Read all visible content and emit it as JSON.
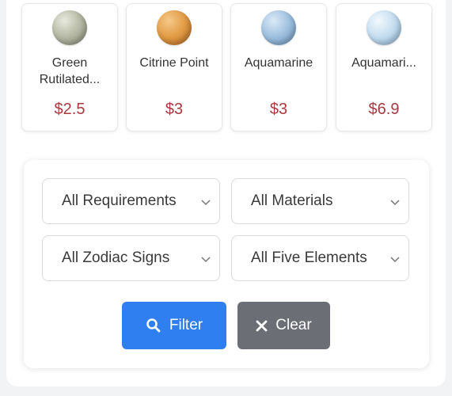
{
  "products": [
    {
      "name": "Green Rutilated...",
      "price": "$2.5",
      "icon": "green-rutilated-quartz-bead"
    },
    {
      "name": "Citrine Point",
      "price": "$3",
      "icon": "citrine-bead"
    },
    {
      "name": "Aquamarine",
      "price": "$3",
      "icon": "aquamarine-bead"
    },
    {
      "name": "Aquamari...",
      "price": "$6.9",
      "icon": "aquamarine-bead"
    }
  ],
  "filters": {
    "requirements": "All Requirements",
    "materials": "All Materials",
    "zodiac": "All Zodiac Signs",
    "elements": "All Five Elements"
  },
  "actions": {
    "filter_label": "Filter",
    "clear_label": "Clear"
  },
  "colors": {
    "price": "#a83a3f",
    "filter_button": "#2f7ff0",
    "clear_button": "#6b6f75"
  }
}
